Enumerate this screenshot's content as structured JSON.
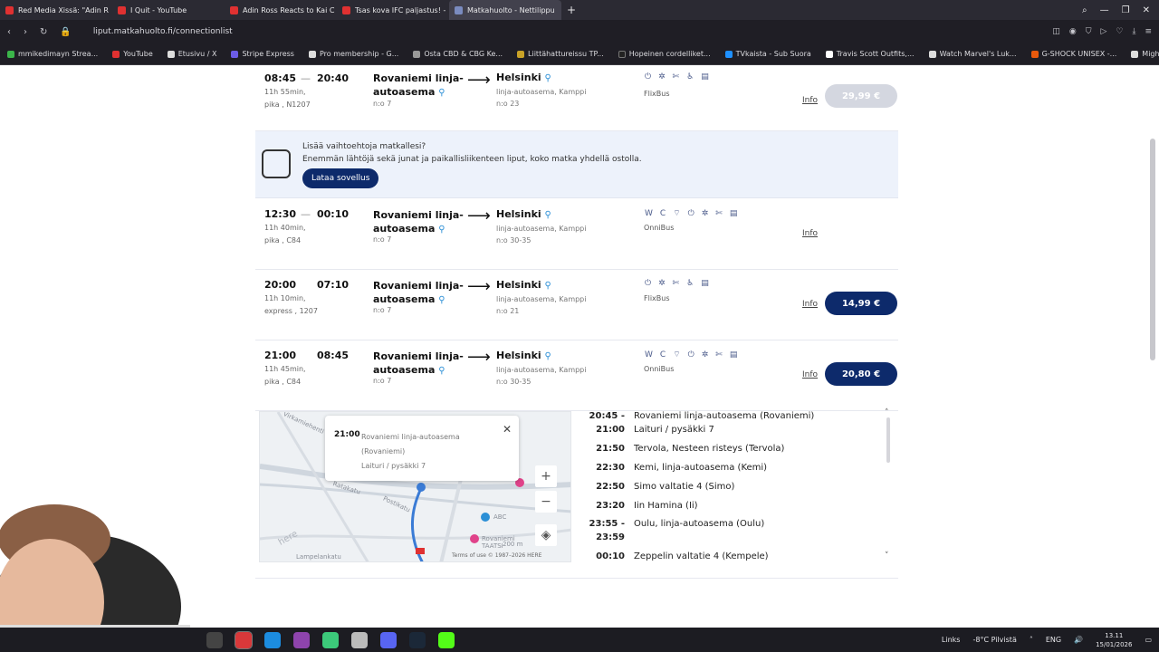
{
  "browser": {
    "tabs": [
      {
        "title": "Red Media Xissä: \"Adin R",
        "color": "#e03131"
      },
      {
        "title": "I Quit - YouTube",
        "color": "#e03131"
      },
      {
        "title": "Adin Ross Reacts to Kai C",
        "color": "#e03131"
      },
      {
        "title": "Tsas kova IFC paljastus! -",
        "color": "#e03131"
      },
      {
        "title": "Matkahuolto - Nettilippu",
        "color": "#7a8bbf",
        "active": true
      }
    ],
    "new_tab": "+",
    "url": "liput.matkahuolto.fi/connectionlist",
    "bookmarks": [
      {
        "label": "mmikedimayn Strea...",
        "color": "#3bb54a"
      },
      {
        "label": "YouTube",
        "color": "#e03131"
      },
      {
        "label": "Etusivu / X",
        "color": "#dddddd"
      },
      {
        "label": "Stripe Express",
        "color": "#6c5ce7"
      },
      {
        "label": "Pro membership - G...",
        "color": "#dddddd"
      },
      {
        "label": "Osta CBD & CBG Ke...",
        "color": "#999999"
      },
      {
        "label": "Liittähattureissu TP...",
        "color": "#c9a227"
      },
      {
        "label": "Hopeinen cordelliket...",
        "color": "#222222"
      },
      {
        "label": "TVkaista - Sub Suora",
        "color": "#1e90ff"
      },
      {
        "label": "Travis Scott Outfits,...",
        "color": "#ffffff"
      },
      {
        "label": "Watch Marvel's Luk...",
        "color": "#dddddd"
      },
      {
        "label": "G-SHOCK UNISEX -...",
        "color": "#e8590c"
      },
      {
        "label": "Mighty Ducks: Bank...",
        "color": "#dddddd"
      }
    ]
  },
  "connections_top": {
    "dep": "08:45",
    "arr": "20:40",
    "duration": "11h 55min,",
    "type": "pika , N1207",
    "from": "Rovaniemi linja-autoasema",
    "from_platform": "n:o 7",
    "to": "Helsinki",
    "to_detail": "linja-autoasema, Kamppi",
    "to_platform": "n:o 23",
    "operator": "FlixBus",
    "info": "Info",
    "price": "29,99 €"
  },
  "promo": {
    "title": "Lisää vaihtoehtoja matkallesi?",
    "text": "Enemmän lähtöjä sekä junat ja paikallisliikenteen liput, koko matka yhdellä ostolla.",
    "button": "Lataa sovellus"
  },
  "connections": [
    {
      "dep": "12:30",
      "arr": "00:10",
      "duration": "11h 40min,",
      "type": "pika , C84",
      "from": "Rovaniemi linja-autoasema",
      "from_platform": "n:o 7",
      "to": "Helsinki",
      "to_detail": "linja-autoasema, Kamppi",
      "to_platform": "n:o 30-35",
      "amenities": "WC",
      "operator": "OnniBus",
      "info": "Info",
      "price": ""
    },
    {
      "dep": "20:00",
      "arr": "07:10",
      "duration": "11h 10min,",
      "type": "express , 1207",
      "from": "Rovaniemi linja-autoasema",
      "from_platform": "n:o 7",
      "to": "Helsinki",
      "to_detail": "linja-autoasema, Kamppi",
      "to_platform": "n:o 21",
      "amenities": "",
      "operator": "FlixBus",
      "info": "Info",
      "price": "14,99 €"
    },
    {
      "dep": "21:00",
      "arr": "08:45",
      "duration": "11h 45min,",
      "type": "pika , C84",
      "from": "Rovaniemi linja-autoasema",
      "from_platform": "n:o 7",
      "to": "Helsinki",
      "to_detail": "linja-autoasema, Kamppi",
      "to_platform": "n:o 30-35",
      "amenities": "WC",
      "operator": "OnniBus",
      "info": "Info",
      "price": "20,80 €"
    }
  ],
  "map": {
    "popup_time": "21:00",
    "popup_lines": [
      "Rovaniemi linja-autoasema",
      "(Rovaniemi)",
      "Laituri / pysäkki 7"
    ],
    "labels": [
      "Virkamiehenti",
      "Ratakatu",
      "Postikatu",
      "Lampelankatu",
      "here",
      "ABC",
      "Rovaniemi TAATSI"
    ],
    "credit": "Terms of use  © 1987–2026 HERE",
    "scale": "200 m"
  },
  "stops": [
    {
      "time": "20:45 -",
      "name": "Rovaniemi linja-autoasema (Rovaniemi)"
    },
    {
      "time": "21:00",
      "name": "Laituri / pysäkki 7"
    },
    {
      "time": "21:50",
      "name": "Tervola, Nesteen risteys (Tervola)"
    },
    {
      "time": "22:30",
      "name": "Kemi, linja-autoasema (Kemi)"
    },
    {
      "time": "22:50",
      "name": "Simo valtatie 4 (Simo)"
    },
    {
      "time": "23:20",
      "name": "Iin Hamina (Ii)"
    },
    {
      "time": "23:55 -",
      "name": "Oulu, linja-autoasema (Oulu)"
    },
    {
      "time": "23:59",
      "name": ""
    },
    {
      "time": "00:10",
      "name": "Zeppelin valtatie 4 (Kempele)"
    }
  ],
  "taskbar": {
    "links": "Links",
    "weather": "-8°C  Pilvistä",
    "lang": "ENG",
    "time": "13.11",
    "date": "15/01/2026"
  }
}
